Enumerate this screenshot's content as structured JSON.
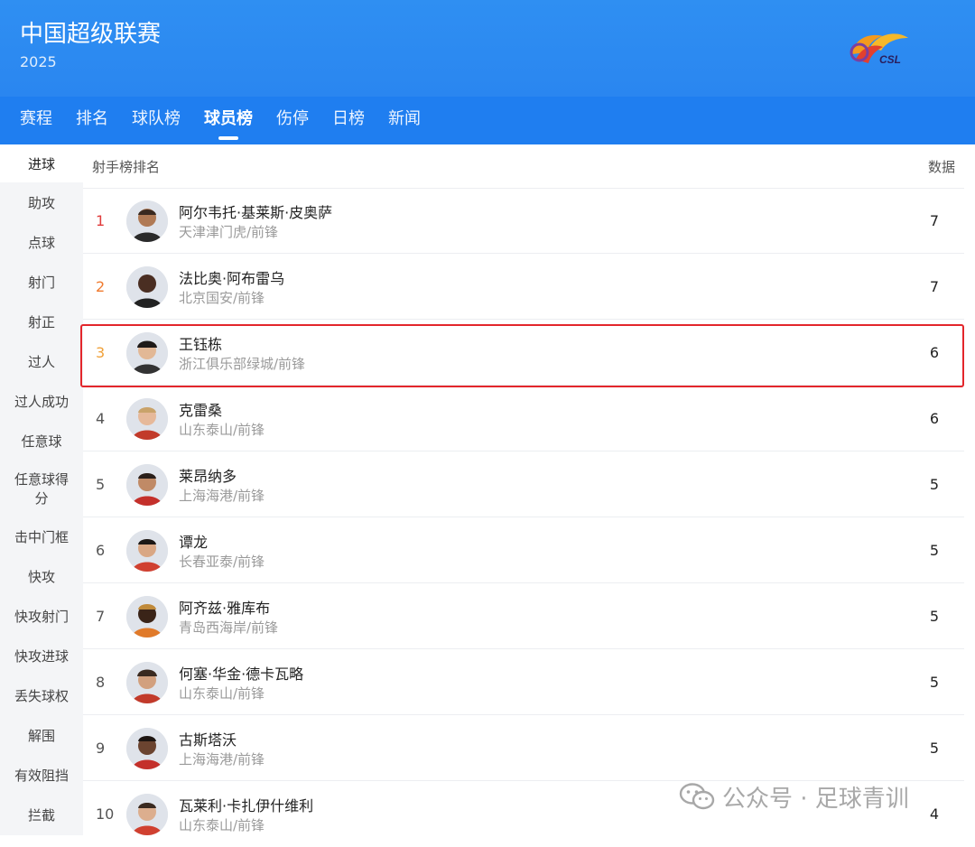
{
  "header": {
    "title": "中国超级联赛",
    "year": "2025",
    "logo_text": "CSL"
  },
  "tabs": [
    {
      "label": "赛程",
      "active": false
    },
    {
      "label": "排名",
      "active": false
    },
    {
      "label": "球队榜",
      "active": false
    },
    {
      "label": "球员榜",
      "active": true
    },
    {
      "label": "伤停",
      "active": false
    },
    {
      "label": "日榜",
      "active": false
    },
    {
      "label": "新闻",
      "active": false
    }
  ],
  "sidebar": {
    "items": [
      {
        "label": "进球",
        "active": true
      },
      {
        "label": "助攻"
      },
      {
        "label": "点球"
      },
      {
        "label": "射门"
      },
      {
        "label": "射正"
      },
      {
        "label": "过人"
      },
      {
        "label": "过人成功"
      },
      {
        "label": "任意球"
      },
      {
        "label": "任意球得分"
      },
      {
        "label": "击中门框"
      },
      {
        "label": "快攻"
      },
      {
        "label": "快攻射门"
      },
      {
        "label": "快攻进球"
      },
      {
        "label": "丢失球权"
      },
      {
        "label": "解围"
      },
      {
        "label": "有效阻挡"
      },
      {
        "label": "拦截"
      }
    ]
  },
  "list": {
    "header_left": "射手榜排名",
    "header_right": "数据",
    "rows": [
      {
        "rank": "1",
        "name": "阿尔韦托·基莱斯·皮奥萨",
        "team": "天津津门虎/前锋",
        "value": "7"
      },
      {
        "rank": "2",
        "name": "法比奥·阿布雷乌",
        "team": "北京国安/前锋",
        "value": "7"
      },
      {
        "rank": "3",
        "name": "王钰栋",
        "team": "浙江俱乐部绿城/前锋",
        "value": "6"
      },
      {
        "rank": "4",
        "name": "克雷桑",
        "team": "山东泰山/前锋",
        "value": "6"
      },
      {
        "rank": "5",
        "name": "莱昂纳多",
        "team": "上海海港/前锋",
        "value": "5"
      },
      {
        "rank": "6",
        "name": "谭龙",
        "team": "长春亚泰/前锋",
        "value": "5"
      },
      {
        "rank": "7",
        "name": "阿齐兹·雅库布",
        "team": "青岛西海岸/前锋",
        "value": "5"
      },
      {
        "rank": "8",
        "name": "何塞·华金·德卡瓦略",
        "team": "山东泰山/前锋",
        "value": "5"
      },
      {
        "rank": "9",
        "name": "古斯塔沃",
        "team": "上海海港/前锋",
        "value": "5"
      },
      {
        "rank": "10",
        "name": "瓦莱利·卡扎伊什维利",
        "team": "山东泰山/前锋",
        "value": "4"
      }
    ]
  },
  "watermark": {
    "text": "公众号 · 足球青训",
    "icon": "wechat-icon"
  },
  "colors": {
    "header_blue": "#2f8ff2",
    "tab_blue": "#1f7ef0",
    "highlight_red": "#e3262b"
  }
}
